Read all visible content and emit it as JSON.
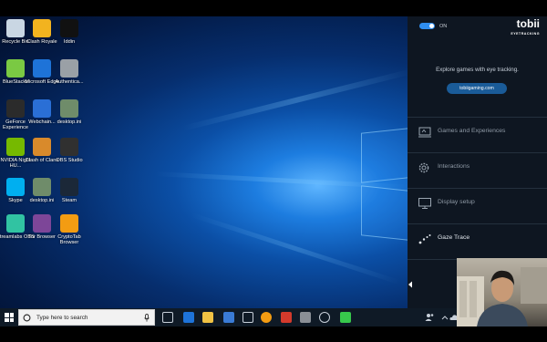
{
  "desktop": {
    "icons": [
      {
        "label": "Recycle Bin",
        "icon": "recycle-bin-icon",
        "color": "#c9d6e3"
      },
      {
        "label": "Clash Royale",
        "icon": "clash-royale-icon",
        "color": "#f2b31f"
      },
      {
        "label": "Iddin",
        "icon": "app-icon",
        "color": "#111111"
      },
      {
        "label": "BlueStacks",
        "icon": "bluestacks-icon",
        "color": "#7ac943"
      },
      {
        "label": "Microsoft Edge",
        "icon": "edge-icon",
        "color": "#1e73d8"
      },
      {
        "label": "Authentica...",
        "icon": "authenticator-icon",
        "color": "#9aa0a6"
      },
      {
        "label": "GeForce Experience",
        "icon": "geforce-icon",
        "color": "#2b2b2b"
      },
      {
        "label": "Webchain...",
        "icon": "webchain-icon",
        "color": "#2a6fd6"
      },
      {
        "label": "desktop.ini",
        "icon": "file-icon",
        "color": "#6f8c6a"
      },
      {
        "label": "NVIDIA Night HU...",
        "icon": "nvidia-icon",
        "color": "#76b900"
      },
      {
        "label": "Clash of Clans",
        "icon": "clash-of-clans-icon",
        "color": "#d98a2b"
      },
      {
        "label": "OBS Studio",
        "icon": "obs-icon",
        "color": "#303030"
      },
      {
        "label": "Skype",
        "icon": "skype-icon",
        "color": "#00aff0"
      },
      {
        "label": "desktop.ini",
        "icon": "file-icon",
        "color": "#6f8c6a"
      },
      {
        "label": "Steam",
        "icon": "steam-icon",
        "color": "#1b2838"
      },
      {
        "label": "Streamlabs OBS",
        "icon": "streamlabs-icon",
        "color": "#31c3a2"
      },
      {
        "label": "Tor Browser",
        "icon": "tor-icon",
        "color": "#7d4698"
      },
      {
        "label": "CryptoTab Browser",
        "icon": "cryptotab-icon",
        "color": "#f39c12"
      }
    ]
  },
  "taskbar": {
    "search_placeholder": "Type here to search",
    "pinned": [
      {
        "icon": "task-view-icon",
        "color": "#c8d0da"
      },
      {
        "icon": "edge-icon",
        "color": "#1e73d8"
      },
      {
        "icon": "file-explorer-icon",
        "color": "#f0c244"
      },
      {
        "icon": "store-icon",
        "color": "#3a7bd5"
      },
      {
        "icon": "mail-icon",
        "color": "#c8d0da"
      },
      {
        "icon": "app-orange-icon",
        "color": "#f39c12"
      },
      {
        "icon": "app-red-icon",
        "color": "#d33a2c"
      },
      {
        "icon": "app-gray-icon",
        "color": "#8a8f96"
      },
      {
        "icon": "app-round-icon",
        "color": "#c8d0da"
      },
      {
        "icon": "line-icon",
        "color": "#37c84c"
      }
    ]
  },
  "tobii": {
    "toggle_label": "ON",
    "brand": "tobii",
    "brand_sub": "EYETRACKING",
    "tagline": "Explore games with eye tracking.",
    "site_button": "tobiigaming.com",
    "menu": [
      {
        "label": "Games and Experiences",
        "icon": "games-icon",
        "active": false
      },
      {
        "label": "Interactions",
        "icon": "gear-icon",
        "active": false
      },
      {
        "label": "Display setup",
        "icon": "monitor-icon",
        "active": false
      },
      {
        "label": "Gaze Trace",
        "icon": "gaze-trace-icon",
        "active": true
      }
    ]
  }
}
